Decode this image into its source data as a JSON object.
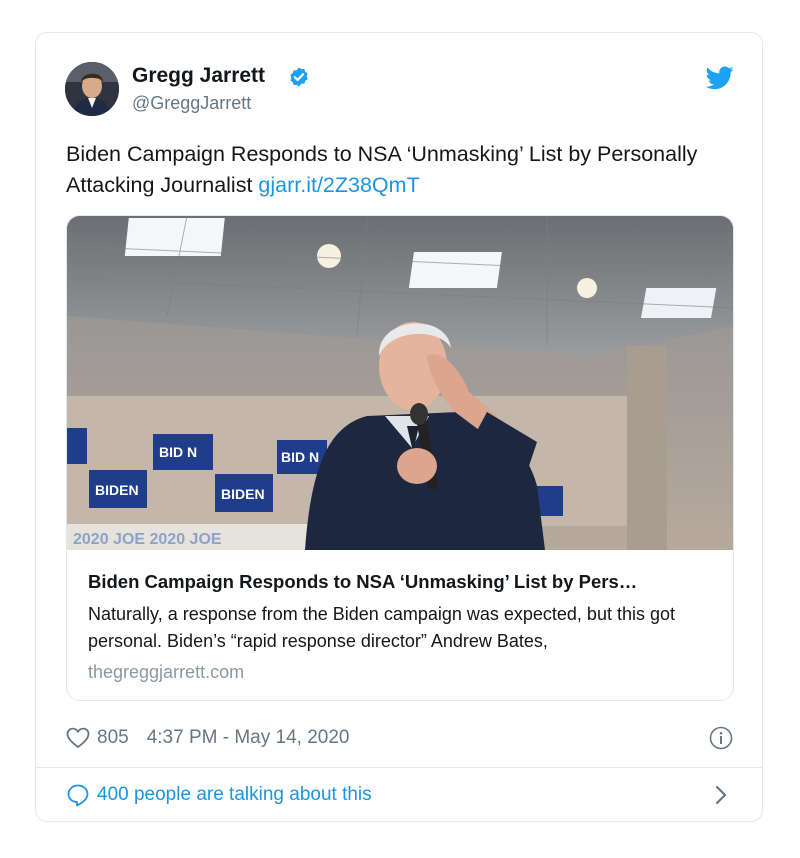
{
  "author": {
    "name": "Gregg Jarrett",
    "handle": "@GreggJarrett"
  },
  "tweet": {
    "text": "Biden Campaign Responds to NSA ‘Unmasking’ List by Personally Attacking Journalist ",
    "link": "gjarr.it/2Z38QmT"
  },
  "link_card": {
    "image_text": "BIDEN",
    "banner_text": "2020 JOE 2020 JOE",
    "title": "Biden Campaign Responds to NSA ‘Unmasking’ List by Pers…",
    "description": "Naturally, a response from the Biden campaign was expected, but this got personal. Biden’s “rapid response director” Andrew Bates,",
    "domain": "thegreggjarrett.com"
  },
  "meta": {
    "likes": "805",
    "timestamp": "4:37 PM - May 14, 2020"
  },
  "footer": {
    "talking": "400 people are talking about this"
  },
  "colors": {
    "link": "#1b95e0",
    "secondary_text": "#657786",
    "border": "#e1e8ed",
    "verified": "#1da1f2"
  },
  "icons": [
    "verified-icon",
    "twitter-bird-icon",
    "heart-icon",
    "info-icon",
    "speech-bubble-icon",
    "chevron-right-icon"
  ]
}
